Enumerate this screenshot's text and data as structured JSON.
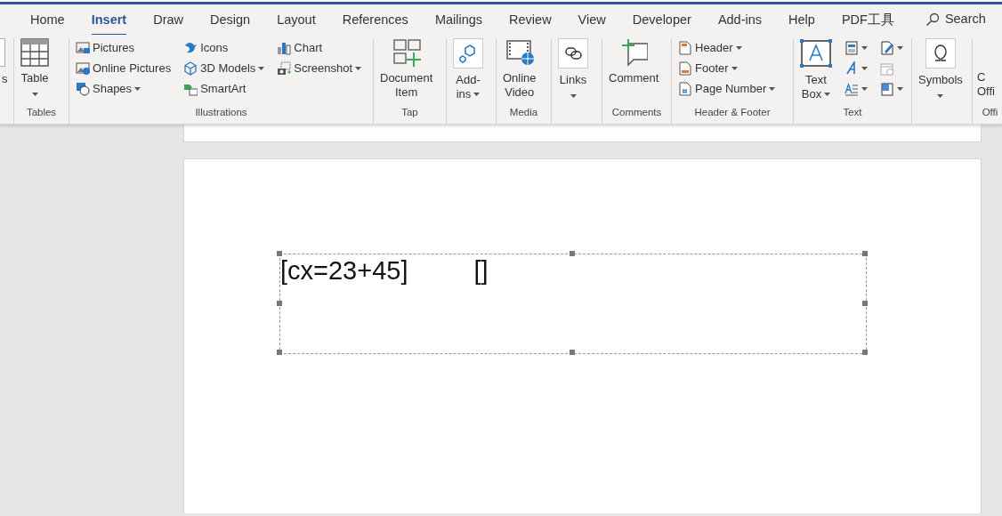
{
  "tabs": [
    {
      "label": "Home",
      "selected": false
    },
    {
      "label": "Insert",
      "selected": true
    },
    {
      "label": "Draw",
      "selected": false
    },
    {
      "label": "Design",
      "selected": false
    },
    {
      "label": "Layout",
      "selected": false
    },
    {
      "label": "References",
      "selected": false
    },
    {
      "label": "Mailings",
      "selected": false
    },
    {
      "label": "Review",
      "selected": false
    },
    {
      "label": "View",
      "selected": false
    },
    {
      "label": "Developer",
      "selected": false
    },
    {
      "label": "Add-ins",
      "selected": false
    },
    {
      "label": "Help",
      "selected": false
    },
    {
      "label": "PDF工具",
      "selected": false
    }
  ],
  "search": {
    "label": "Search"
  },
  "groups": [
    {
      "columns": [
        [
          {
            "kind": "cut",
            "lines": [
              "s"
            ]
          }
        ]
      ]
    },
    {
      "label": "Tables",
      "columns": [
        [
          {
            "kind": "large",
            "lines": [
              "Table"
            ],
            "menu": true
          }
        ]
      ]
    },
    {
      "label": "Illustrations",
      "columns": [
        [
          {
            "kind": "small",
            "label": "Pictures",
            "menu": false
          },
          {
            "kind": "small",
            "label": "Online Pictures",
            "menu": false
          },
          {
            "kind": "small",
            "label": "Shapes",
            "menu": true
          }
        ],
        [
          {
            "kind": "small",
            "label": "Icons",
            "menu": false
          },
          {
            "kind": "small",
            "label": "3D Models",
            "menu": true
          },
          {
            "kind": "small",
            "label": "SmartArt",
            "menu": false
          }
        ],
        [
          {
            "kind": "small",
            "label": "Chart",
            "menu": false
          },
          {
            "kind": "small",
            "label": "Screenshot",
            "menu": true
          }
        ]
      ]
    },
    {
      "label": "Tap",
      "columns": [
        [
          {
            "kind": "large",
            "lines": [
              "Document",
              "Item"
            ],
            "menu": false
          }
        ]
      ]
    },
    {
      "columns": [
        [
          {
            "kind": "large",
            "lines": [
              "Add-",
              "ins"
            ],
            "menu": true
          }
        ]
      ]
    },
    {
      "label": "Media",
      "columns": [
        [
          {
            "kind": "large",
            "lines": [
              "Online",
              "Video"
            ],
            "menu": false
          }
        ]
      ]
    },
    {
      "columns": [
        [
          {
            "kind": "large",
            "lines": [
              "Links"
            ],
            "menu": true
          }
        ]
      ]
    },
    {
      "label": "Comments",
      "columns": [
        [
          {
            "kind": "large",
            "lines": [
              "Comment"
            ],
            "menu": false
          }
        ]
      ]
    },
    {
      "label": "Header & Footer",
      "columns": [
        [
          {
            "kind": "small",
            "label": "Header",
            "menu": true
          },
          {
            "kind": "small",
            "label": "Footer",
            "menu": true
          },
          {
            "kind": "small",
            "label": "Page Number",
            "menu": true
          }
        ]
      ]
    },
    {
      "label": "Text",
      "columns": [
        [
          {
            "kind": "large",
            "lines": [
              "Text",
              "Box"
            ],
            "menu": true
          }
        ],
        [
          {
            "kind": "icon",
            "menu": true
          },
          {
            "kind": "icon",
            "menu": true
          },
          {
            "kind": "icon",
            "menu": true
          }
        ],
        [
          {
            "kind": "icon",
            "menu": true
          },
          {
            "kind": "icon",
            "menu": false
          },
          {
            "kind": "icon",
            "menu": true
          }
        ]
      ]
    },
    {
      "columns": [
        [
          {
            "kind": "large",
            "lines": [
              "Symbols"
            ],
            "menu": true
          }
        ]
      ]
    },
    {
      "label": "Offi",
      "columns": [
        [
          {
            "kind": "cut",
            "lines": [
              "C",
              "Offi"
            ]
          }
        ]
      ]
    }
  ],
  "document": {
    "textbox": {
      "parts": [
        "[cx=23+45]",
        "[]"
      ]
    }
  }
}
